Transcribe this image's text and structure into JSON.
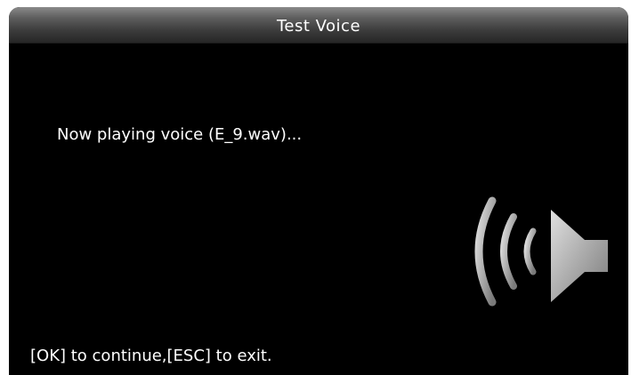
{
  "window": {
    "title": "Test Voice"
  },
  "main": {
    "message": "Now playing voice (E_9.wav)...",
    "speaker_icon": "speaker-sound-icon"
  },
  "footer": {
    "hint": "[OK] to continue,[ESC] to exit."
  },
  "colors": {
    "background": "#000000",
    "text": "#ffffff",
    "icon": "#b0b0b0"
  }
}
